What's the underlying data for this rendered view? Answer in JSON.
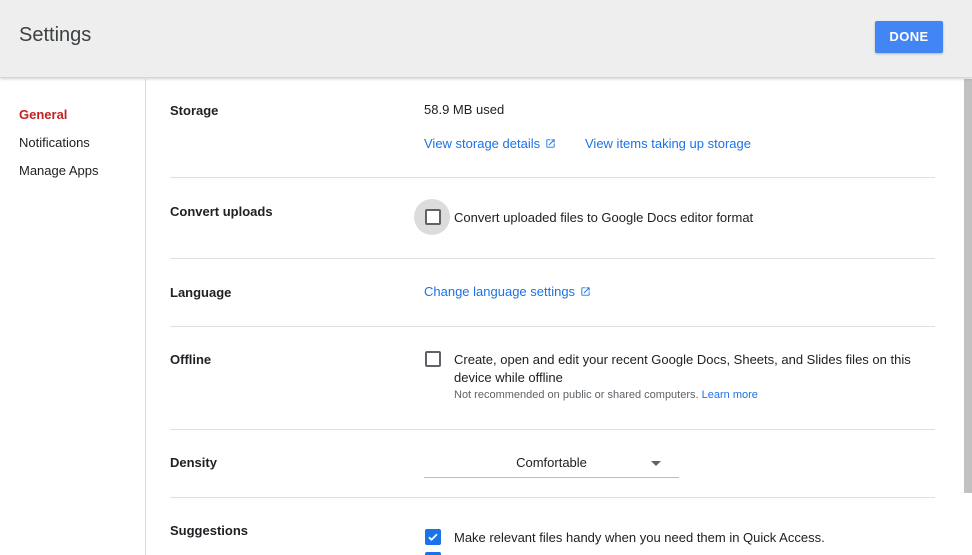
{
  "header": {
    "title": "Settings",
    "done_label": "DONE"
  },
  "sidebar": {
    "items": [
      {
        "label": "General",
        "active": true
      },
      {
        "label": "Notifications",
        "active": false
      },
      {
        "label": "Manage Apps",
        "active": false
      }
    ]
  },
  "storage": {
    "label": "Storage",
    "used": "58.9 MB used",
    "details_link": "View storage details",
    "items_link": "View items taking up storage"
  },
  "convert": {
    "label": "Convert uploads",
    "option": "Convert uploaded files to Google Docs editor format",
    "checked": false
  },
  "language": {
    "label": "Language",
    "link": "Change language settings"
  },
  "offline": {
    "label": "Offline",
    "option_line1": "Create, open and edit your recent Google Docs, Sheets, and Slides files on this",
    "option_line2": "device while offline",
    "note": "Not recommended on public or shared computers.",
    "learn_more": "Learn more",
    "checked": false
  },
  "density": {
    "label": "Density",
    "value": "Comfortable"
  },
  "suggestions": {
    "label": "Suggestions",
    "option": "Make relevant files handy when you need them in Quick Access.",
    "checked": true
  },
  "colors": {
    "accent": "#1a73e8",
    "done_button": "#4285f4",
    "active_nav": "#c5221f"
  }
}
